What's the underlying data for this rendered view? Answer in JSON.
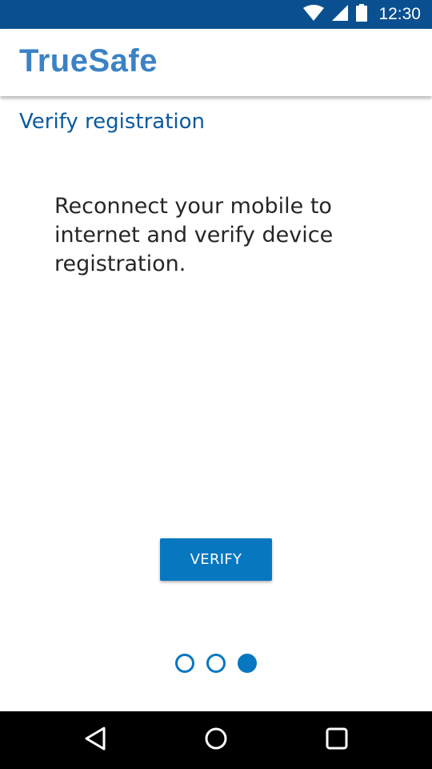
{
  "status_bar": {
    "time": "12:30",
    "icons": [
      "wifi-icon",
      "signal-icon",
      "battery-icon"
    ],
    "background": "#0a4f8f"
  },
  "app_bar": {
    "brand": "TrueSafe",
    "brand_color": "#3b82c4"
  },
  "main": {
    "title": "Verify registration",
    "message": "Reconnect your mobile to internet and verify device registration.",
    "verify_label": "VERIFY",
    "accent": "#0777c0"
  },
  "pager": {
    "total": 3,
    "current": 3
  },
  "nav_bar": {
    "buttons": [
      "back-icon",
      "home-icon",
      "recents-icon"
    ]
  }
}
